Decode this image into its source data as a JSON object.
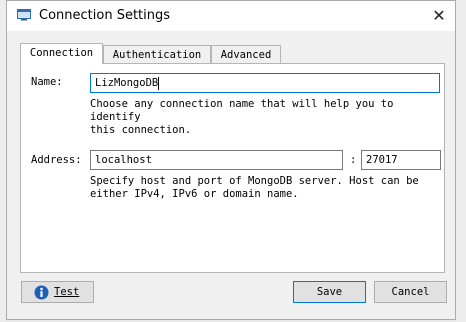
{
  "window": {
    "title": "Connection Settings"
  },
  "tabs": [
    {
      "label": "Connection"
    },
    {
      "label": "Authentication"
    },
    {
      "label": "Advanced"
    }
  ],
  "connection": {
    "name_label": "Name:",
    "name_value": "LizMongoDB",
    "name_help": [
      "Choose any connection name that will help you to identify",
      "this connection."
    ],
    "address_label": "Address:",
    "host_value": "localhost",
    "port_separator": ":",
    "port_value": "27017",
    "address_help": [
      "Specify host and port of MongoDB server. Host can be",
      "either IPv4, IPv6 or domain name."
    ]
  },
  "buttons": {
    "test_label": "Test",
    "save_label": "Save",
    "cancel_label": "Cancel"
  },
  "icons": {
    "app": "window-icon",
    "close": "close-icon",
    "info": "info-icon"
  },
  "colors": {
    "accent": "#0078d7",
    "info_icon": "#1f5fb4"
  }
}
